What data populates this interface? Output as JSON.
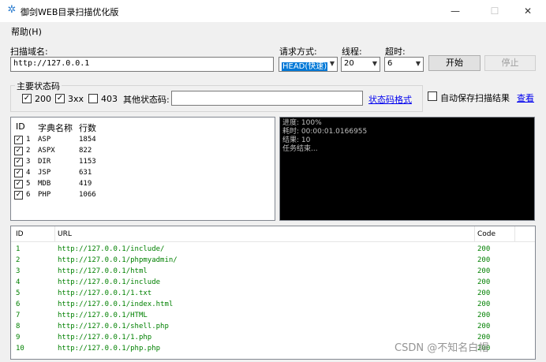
{
  "window": {
    "title": "御剑WEB目录扫描优化版",
    "minimize": "—",
    "maximize": "☐",
    "close": "✕"
  },
  "menu": {
    "help": "帮助(H)"
  },
  "scan": {
    "domain_label": "扫描域名:",
    "domain_value": "http://127.0.0.1",
    "method_label": "请求方式:",
    "method_value": "HEAD(快速)",
    "threads_label": "线程:",
    "threads_value": "20",
    "timeout_label": "超时:",
    "timeout_value": "6",
    "start_button": "开始",
    "stop_button": "停止"
  },
  "status_codes": {
    "group_label": "主要状态码",
    "codes": [
      {
        "label": "200",
        "checked": true
      },
      {
        "label": "3xx",
        "checked": true
      },
      {
        "label": "403",
        "checked": false
      }
    ],
    "other_label": "其他状态码:",
    "other_value": "",
    "format_link": "状态码格式"
  },
  "autosave": {
    "label": "自动保存扫描结果",
    "checked": false,
    "view_link": "查看"
  },
  "dictionary": {
    "headers": [
      "ID",
      "字典名称",
      "行数"
    ],
    "rows": [
      {
        "id": "1",
        "name": "ASP",
        "lines": "1854",
        "checked": true
      },
      {
        "id": "2",
        "name": "ASPX",
        "lines": "822",
        "checked": true
      },
      {
        "id": "3",
        "name": "DIR",
        "lines": "1153",
        "checked": true
      },
      {
        "id": "4",
        "name": "JSP",
        "lines": "631",
        "checked": true
      },
      {
        "id": "5",
        "name": "MDB",
        "lines": "419",
        "checked": true
      },
      {
        "id": "6",
        "name": "PHP",
        "lines": "1066",
        "checked": true
      }
    ]
  },
  "console": {
    "lines": [
      "进度: 100%",
      "耗时: 00:00:01.0166955",
      "结果: 10",
      "任务结束..."
    ]
  },
  "results": {
    "headers": [
      "ID",
      "URL",
      "Code"
    ],
    "rows": [
      {
        "id": "1",
        "url": "http://127.0.0.1/include/",
        "code": "200"
      },
      {
        "id": "2",
        "url": "http://127.0.0.1/phpmyadmin/",
        "code": "200"
      },
      {
        "id": "3",
        "url": "http://127.0.0.1/html",
        "code": "200"
      },
      {
        "id": "4",
        "url": "http://127.0.0.1/include",
        "code": "200"
      },
      {
        "id": "5",
        "url": "http://127.0.0.1/1.txt",
        "code": "200"
      },
      {
        "id": "6",
        "url": "http://127.0.0.1/index.html",
        "code": "200"
      },
      {
        "id": "7",
        "url": "http://127.0.0.1/HTML",
        "code": "200"
      },
      {
        "id": "8",
        "url": "http://127.0.0.1/shell.php",
        "code": "200"
      },
      {
        "id": "9",
        "url": "http://127.0.0.1/1.php",
        "code": "200"
      },
      {
        "id": "10",
        "url": "http://127.0.0.1/php.php",
        "code": "200"
      }
    ]
  },
  "watermark": "CSDN @不知名白帽",
  "colors": {
    "link": "#0000ee",
    "result_text": "#008000",
    "console_bg": "#000000",
    "selected": "#0078d7"
  }
}
